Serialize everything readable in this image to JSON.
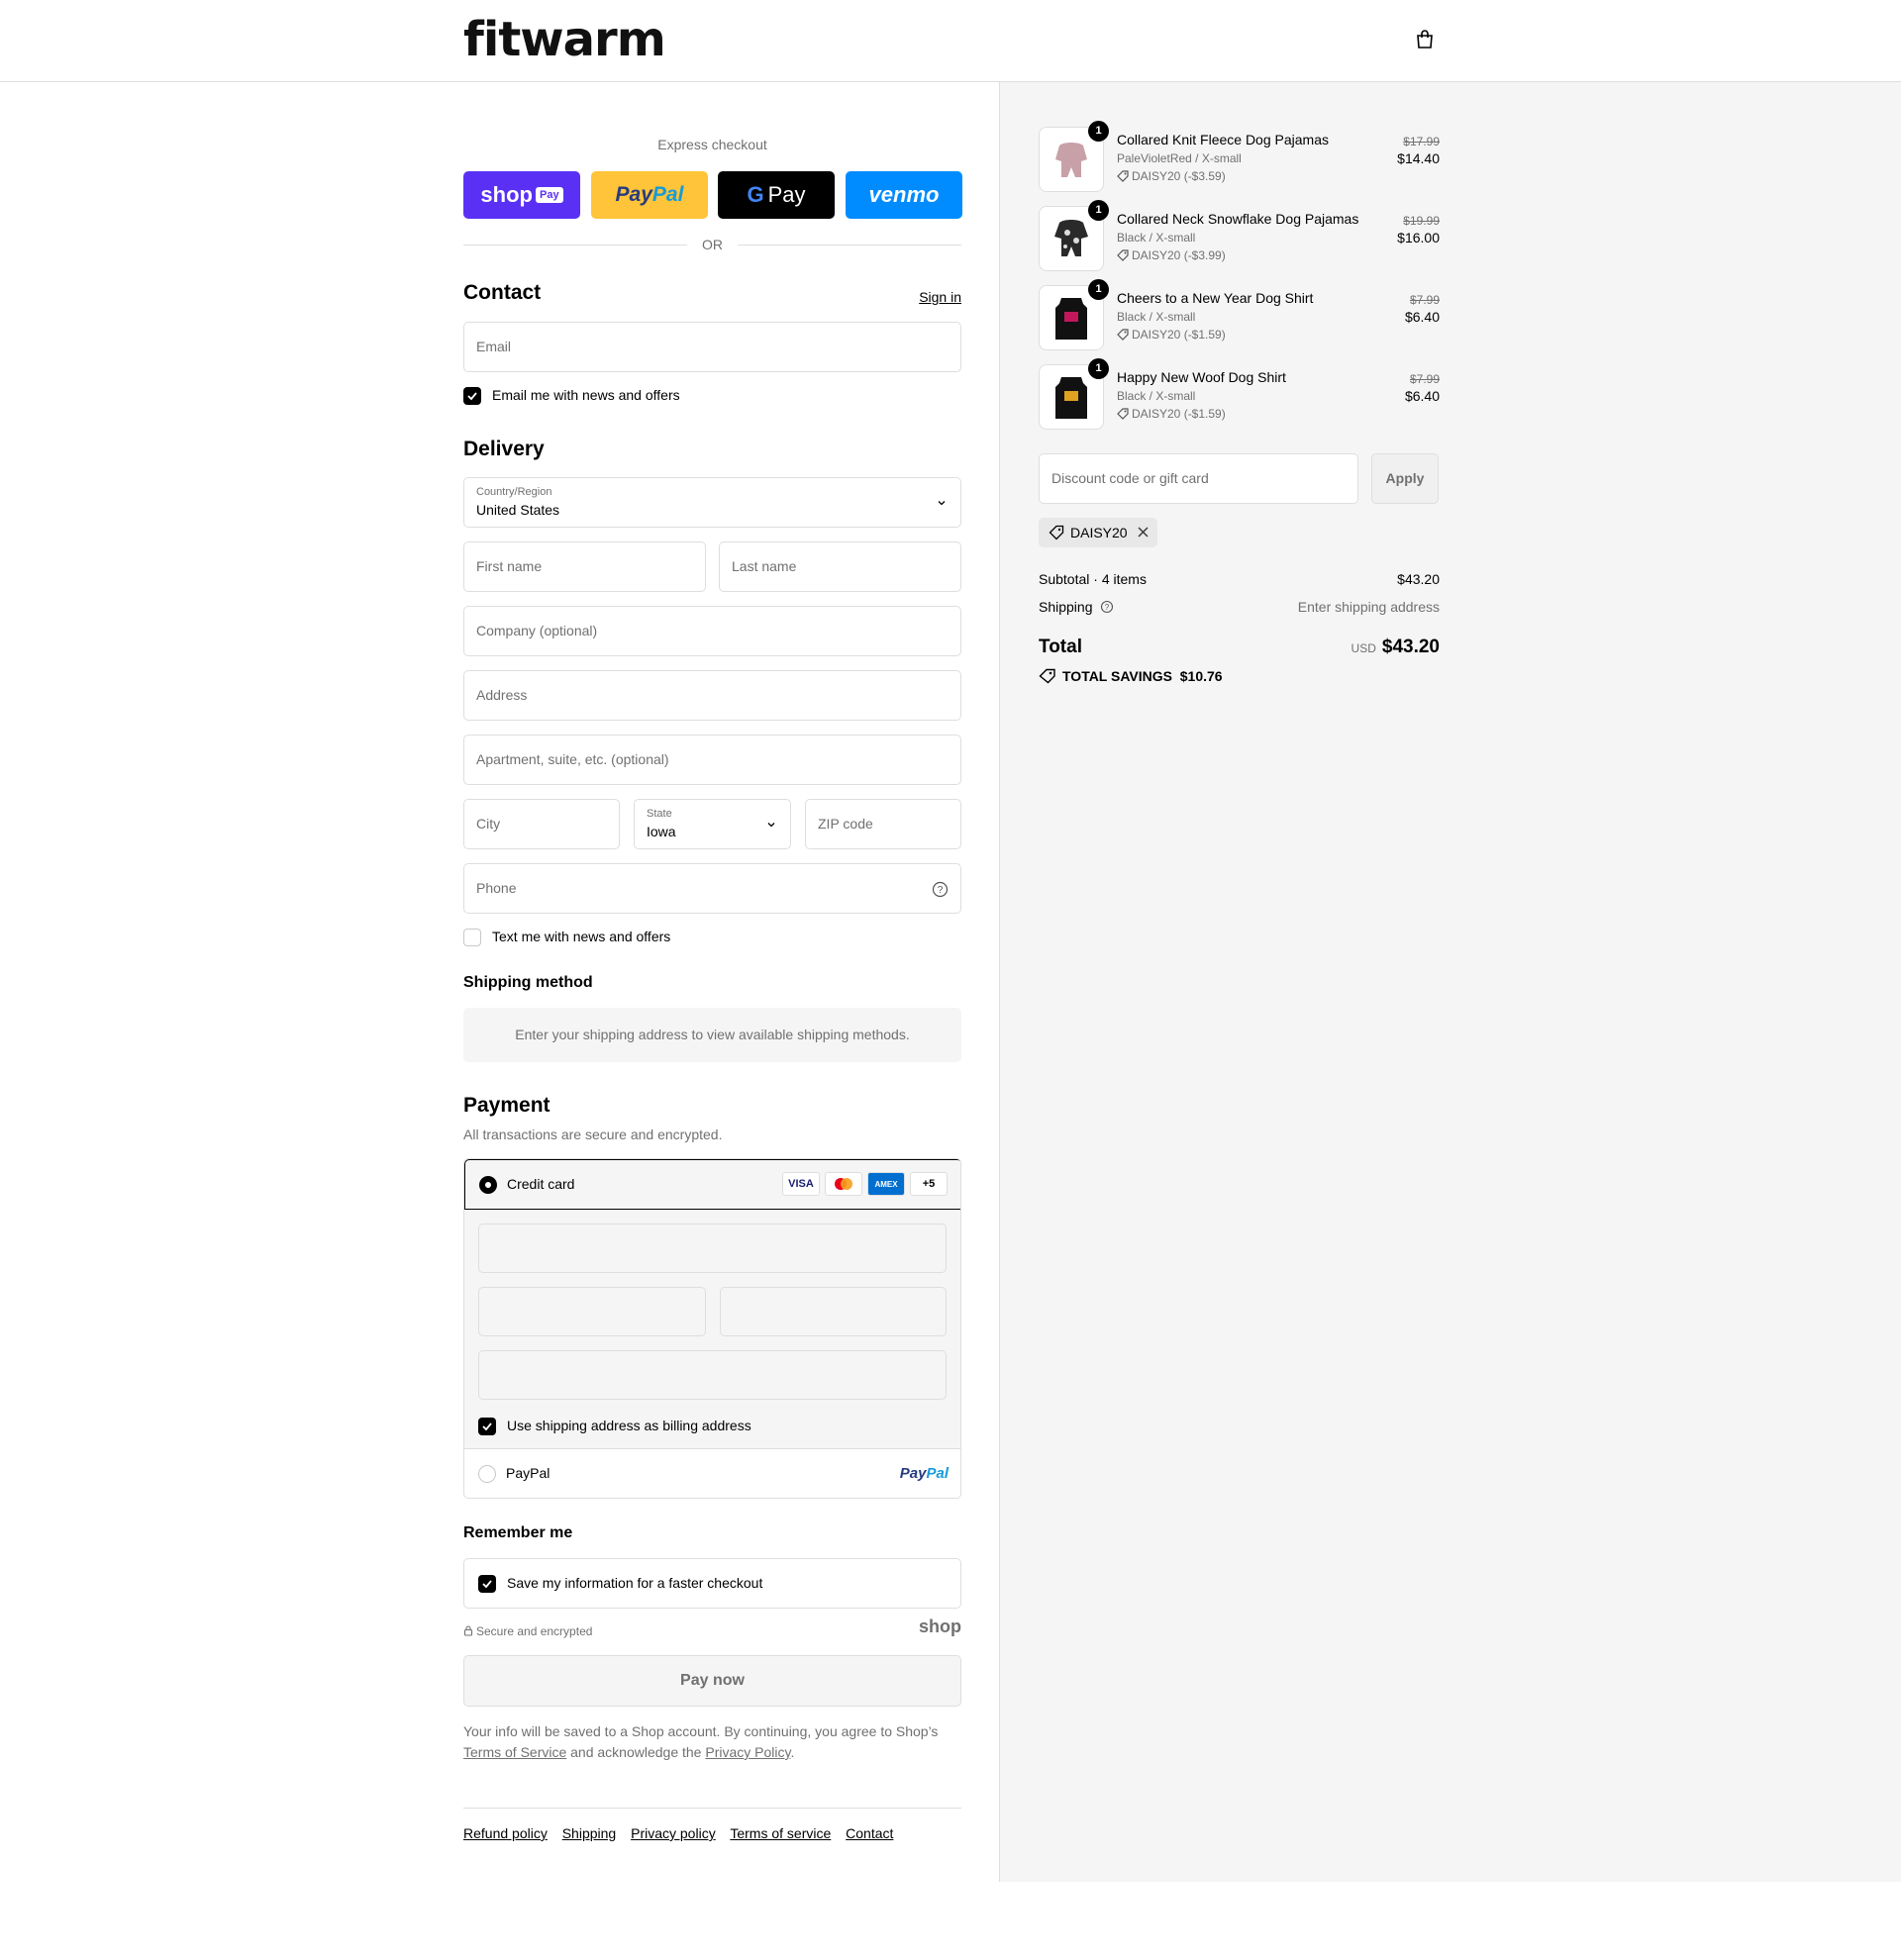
{
  "header": {
    "logo": "fitwarm"
  },
  "express": {
    "title": "Express checkout",
    "shop_label": "shop",
    "shop_tag": "Pay",
    "paypal_a": "Pay",
    "paypal_b": "Pal",
    "gpay_g": "G",
    "gpay_label": "Pay",
    "venmo_label": "venmo",
    "or": "OR"
  },
  "contact": {
    "title": "Contact",
    "sign_in": "Sign in",
    "email_placeholder": "Email",
    "news_label": "Email me with news and offers"
  },
  "delivery": {
    "title": "Delivery",
    "country_label": "Country/Region",
    "country_value": "United States",
    "first_name": "First name",
    "last_name": "Last name",
    "company": "Company (optional)",
    "address": "Address",
    "apartment": "Apartment, suite, etc. (optional)",
    "city": "City",
    "state_label": "State",
    "state_value": "Iowa",
    "zip": "ZIP code",
    "phone": "Phone",
    "text_label": "Text me with news and offers"
  },
  "shipping_method": {
    "title": "Shipping method",
    "message": "Enter your shipping address to view available shipping methods."
  },
  "payment": {
    "title": "Payment",
    "subtitle": "All transactions are secure and encrypted.",
    "credit_card_label": "Credit card",
    "brands": [
      "VISA",
      "MC",
      "AMEX",
      "+5"
    ],
    "billing_label": "Use shipping address as billing address",
    "paypal_label": "PayPal",
    "paypal_logo_a": "Pay",
    "paypal_logo_b": "Pal"
  },
  "remember": {
    "title": "Remember me",
    "save_label": "Save my information for a faster checkout",
    "secure": "Secure and encrypted",
    "shop_word": "shop"
  },
  "pay_now": "Pay now",
  "legal": {
    "text1": "Your info will be saved to a Shop account. By continuing, you agree to Shop’s ",
    "tos": "Terms of Service",
    "text2": " and acknowledge the ",
    "privacy": "Privacy Policy",
    "text3": "."
  },
  "footer": {
    "links": [
      "Refund policy",
      "Shipping",
      "Privacy policy",
      "Terms of service",
      "Contact"
    ]
  },
  "colors": {
    "shop": "#5a31f4",
    "paypal": "#ffc439",
    "venmo": "#008cff",
    "summary_bg": "#f5f5f5"
  },
  "summary": {
    "items": [
      {
        "name": "Collared Knit Fleece Dog Pajamas",
        "variant": "PaleVioletRed / X-small",
        "discount": "DAISY20 (-$3.59)",
        "original": "$17.99",
        "price": "$14.40",
        "qty": "1"
      },
      {
        "name": "Collared Neck Snowflake Dog Pajamas",
        "variant": "Black / X-small",
        "discount": "DAISY20 (-$3.99)",
        "original": "$19.99",
        "price": "$16.00",
        "qty": "1"
      },
      {
        "name": "Cheers to a New Year Dog Shirt",
        "variant": "Black / X-small",
        "discount": "DAISY20 (-$1.59)",
        "original": "$7.99",
        "price": "$6.40",
        "qty": "1"
      },
      {
        "name": "Happy New Woof Dog Shirt",
        "variant": "Black / X-small",
        "discount": "DAISY20 (-$1.59)",
        "original": "$7.99",
        "price": "$6.40",
        "qty": "1"
      }
    ],
    "discount_placeholder": "Discount code or gift card",
    "apply": "Apply",
    "code": "DAISY20",
    "subtotal_label": "Subtotal · 4 items",
    "subtotal_value": "$43.20",
    "shipping_label": "Shipping",
    "shipping_value": "Enter shipping address",
    "total_label": "Total",
    "currency": "USD",
    "total_value": "$43.20",
    "savings_label": "TOTAL SAVINGS",
    "savings_value": "$10.76"
  }
}
